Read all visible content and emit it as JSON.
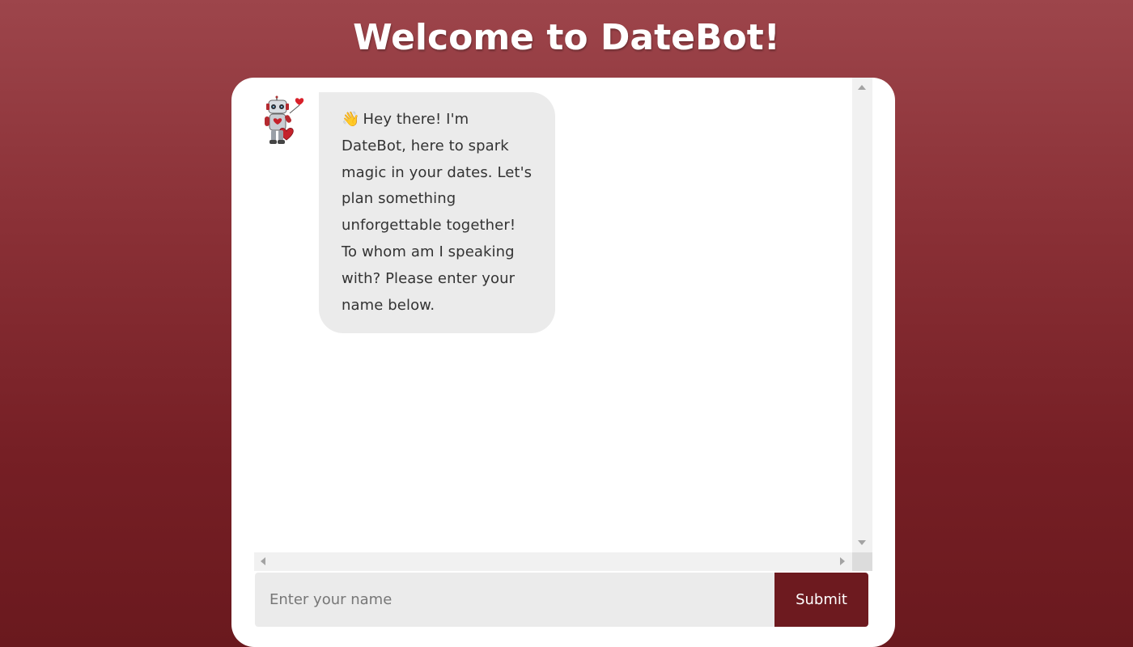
{
  "page": {
    "title": "Welcome to DateBot!"
  },
  "chat": {
    "messages": [
      {
        "sender": "bot",
        "avatar_icon": "robot-with-heart-balloon-icon",
        "emoji": "👋",
        "text": "Hey there! I'm DateBot, here to spark magic in your dates. Let's plan something unforgettable together! To whom am I speaking with? Please enter your name below."
      }
    ]
  },
  "input": {
    "placeholder": "Enter your name",
    "value": ""
  },
  "submit": {
    "label": "Submit"
  },
  "colors": {
    "background_top": "#9d454b",
    "background_bottom": "#6a191e",
    "accent": "#6d1a1f",
    "bubble": "#ebebeb",
    "card": "#ffffff"
  }
}
